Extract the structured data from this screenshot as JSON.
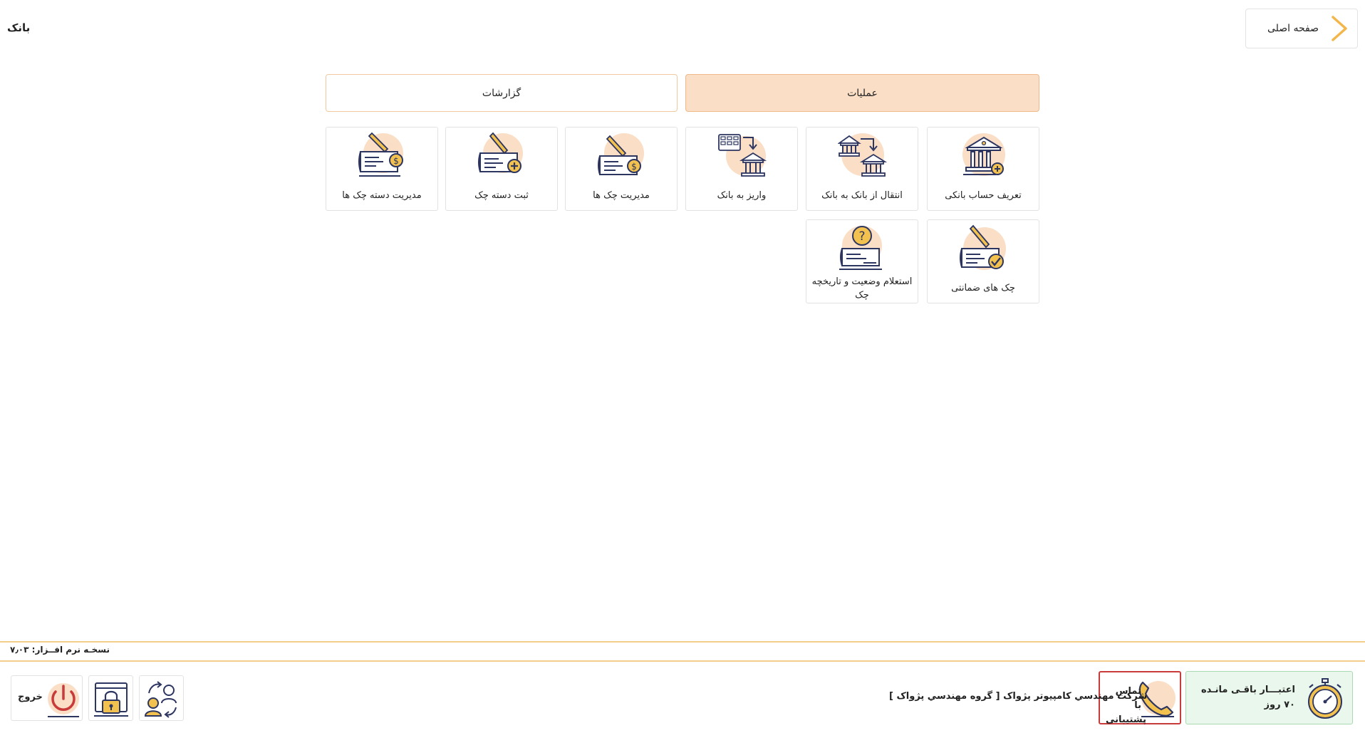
{
  "header": {
    "home_label": "صفحه اصلی",
    "page_title": "بانک"
  },
  "tabs": {
    "operations": "عملیات",
    "reports": "گزارشات"
  },
  "tiles": [
    {
      "label": "تعریف حساب بانکی",
      "icon": "bank-add-icon"
    },
    {
      "label": "انتقال از بانک به بانک",
      "icon": "bank-transfer-icon"
    },
    {
      "label": "واریز به بانک",
      "icon": "cash-deposit-bank-icon"
    },
    {
      "label": "مدیریت چک ها",
      "icon": "check-dollar-icon"
    },
    {
      "label": "ثبت دسته چک",
      "icon": "check-add-icon"
    },
    {
      "label": "مدیریت دسته چک ها",
      "icon": "checkbook-dollar-icon"
    },
    {
      "label": "چک های ضمانتی",
      "icon": "check-approved-icon"
    },
    {
      "label": "استعلام وضعیت و تاریخچه چک",
      "icon": "check-inquiry-icon"
    }
  ],
  "footer": {
    "version": "نسخـه نرم افــزار: ۷٫۰۳",
    "credit_label": "اعتبـــار باقـی مانـده",
    "credit_days": "۷۰ روز",
    "support_label": "تماس با پشتیبانی",
    "company": "شرکت مهندسي کامپیوتر پژواک [ گروه مهندسي پژواک ]",
    "exit_label": "خروج"
  },
  "colors": {
    "accent_peach": "#fadec6",
    "accent_orange": "#f0b98a",
    "icon_navy": "#2d3561",
    "icon_gold": "#f2c14e",
    "support_red": "#c93a3a",
    "credit_green": "#eaf7ec"
  }
}
